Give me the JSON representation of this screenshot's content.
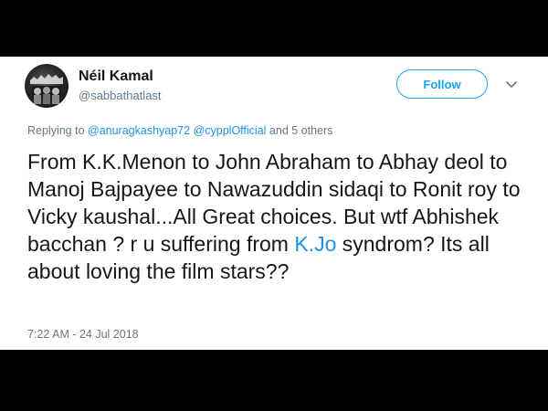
{
  "user": {
    "display_name": "Néil Kamal",
    "handle": "@sabbathatlast"
  },
  "follow_button": {
    "label": "Follow"
  },
  "icons": {
    "menu": "chevron-down-icon",
    "avatar": "band-logo-avatar"
  },
  "reply_context": {
    "prefix": "Replying to ",
    "mention_1": "@anuragkashyap72",
    "separator": " ",
    "mention_2": "@cypplOfficial",
    "suffix": " and 5 others"
  },
  "tweet": {
    "text_part_1": "From K.K.Menon to John Abraham to Abhay deol to Manoj Bajpayee to Nawazuddin sidaqi to Ronit roy to Vicky kaushal...All Great choices. But wtf Abhishek bacchan ? r u suffering from ",
    "link_text": "K.Jo",
    "text_part_2": " syndrom? Its all about loving the film stars??"
  },
  "timestamp": "7:22 AM - 24 Jul 2018",
  "colors": {
    "accent": "#1da1f2",
    "link": "#1b95e0",
    "secondary_text": "#657786",
    "primary_text": "#14171a",
    "frame": "#000000"
  }
}
